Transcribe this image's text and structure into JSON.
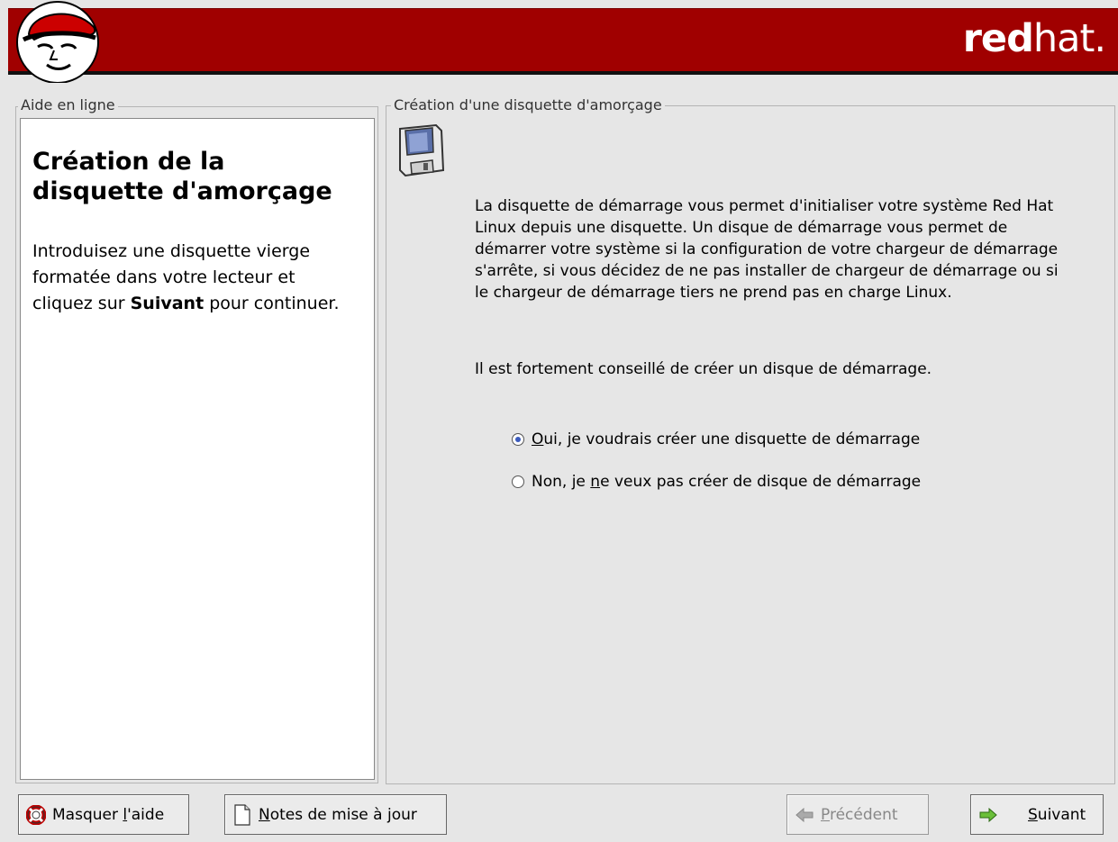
{
  "header": {
    "brand_bold": "red",
    "brand_light": "hat",
    "brand_dot": "."
  },
  "help": {
    "frame_title": "Aide en ligne",
    "heading": "Création de la disquette d'amorçage",
    "text_before": "Introduisez une disquette vierge formatée dans votre lecteur et cliquez sur ",
    "text_bold": "Suivant",
    "text_after": " pour continuer."
  },
  "main": {
    "frame_title": "Création d'une disquette d'amorçage",
    "paragraph1": "La disquette de démarrage vous permet d'initialiser votre système Red Hat Linux depuis une disquette. Un disque de démarrage vous permet de démarrer votre système si la configuration de votre chargeur de démarrage s'arrête, si vous décidez de ne pas installer de chargeur de démarrage ou si le chargeur de démarrage tiers ne prend pas en charge Linux.",
    "paragraph2": "Il est fortement conseillé de créer un disque de démarrage.",
    "option_yes_mnemonic": "O",
    "option_yes_rest": "ui, je voudrais créer une disquette de démarrage",
    "option_no_pre": "Non, je ",
    "option_no_mnemonic": "n",
    "option_no_rest": "e veux pas créer de disque de démarrage",
    "selected": "yes"
  },
  "footer": {
    "hide_help_pre": "Masquer ",
    "hide_help_mnemonic": "l",
    "hide_help_rest": "'aide",
    "notes_mnemonic": "N",
    "notes_rest": "otes de mise à jour",
    "prev_mnemonic": "P",
    "prev_rest": "récédent",
    "next_mnemonic": "S",
    "next_rest": "uivant"
  },
  "colors": {
    "banner": "#a00000",
    "radio_selected": "#3b5bbd"
  }
}
